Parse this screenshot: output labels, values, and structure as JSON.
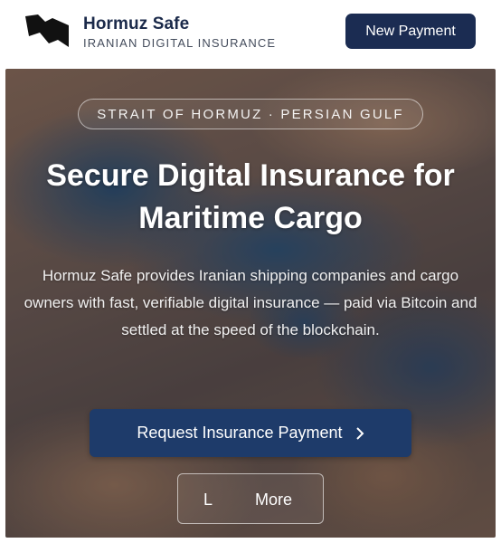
{
  "header": {
    "brand_name": "Hormuz Safe",
    "brand_tagline": "IRANIAN DIGITAL INSURANCE",
    "logo_icon": "strait-logo-icon",
    "new_payment_label": "New Payment"
  },
  "hero": {
    "kicker": "STRAIT OF HORMUZ · PERSIAN GULF",
    "title": "Secure Digital Insurance for Maritime Cargo",
    "description": "Hormuz Safe provides Iranian shipping companies and cargo owners with fast, verifiable digital insurance — paid via Bitcoin and settled at the speed of the blockchain.",
    "cta_label": "Request Insurance Payment",
    "cta_icon": "chevron-right-icon",
    "more_prefix": "L",
    "more_label": "More"
  },
  "colors": {
    "brand_navy": "#1b2c52",
    "cta_blue": "#1e3b6a",
    "white": "#ffffff"
  }
}
